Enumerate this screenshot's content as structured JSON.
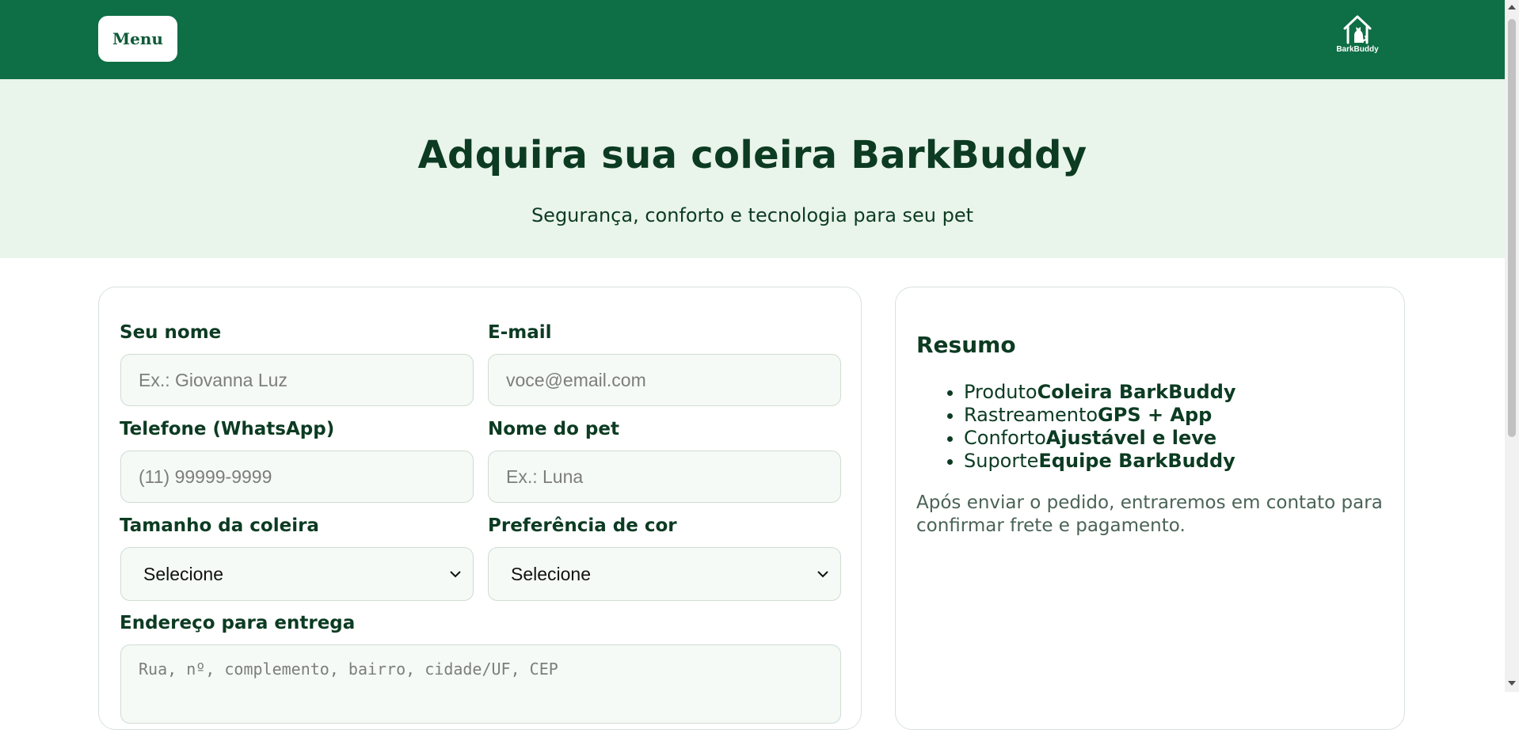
{
  "header": {
    "menu_label": "Menu",
    "logo_text": "BarkBuddy",
    "logo_icon": "house-dog-icon"
  },
  "hero": {
    "title": "Adquira sua coleira BarkBuddy",
    "subtitle": "Segurança, conforto e tecnologia para seu pet"
  },
  "form": {
    "name": {
      "label": "Seu nome",
      "placeholder": "Ex.: Giovanna Luz"
    },
    "email": {
      "label": "E-mail",
      "placeholder": "voce@email.com"
    },
    "phone": {
      "label": "Telefone (WhatsApp)",
      "placeholder": "(11) 99999-9999"
    },
    "pet": {
      "label": "Nome do pet",
      "placeholder": "Ex.: Luna"
    },
    "size": {
      "label": "Tamanho da coleira",
      "selected": "Selecione"
    },
    "color": {
      "label": "Preferência de cor",
      "selected": "Selecione"
    },
    "address": {
      "label": "Endereço para entrega",
      "placeholder": "Rua, nº, complemento, bairro, cidade/UF, CEP"
    }
  },
  "summary": {
    "title": "Resumo",
    "items": [
      {
        "key": "Produto",
        "value": "Coleira BarkBuddy"
      },
      {
        "key": "Rastreamento",
        "value": "GPS + App"
      },
      {
        "key": "Conforto",
        "value": "Ajustável e leve"
      },
      {
        "key": "Suporte",
        "value": "Equipe BarkBuddy"
      }
    ],
    "note": "Após enviar o pedido, entraremos em contato para confirmar frete e pagamento."
  },
  "colors": {
    "brand_green": "#0e6e45",
    "hero_bg": "#e9f4ea",
    "text_dark": "#0c3b22"
  }
}
